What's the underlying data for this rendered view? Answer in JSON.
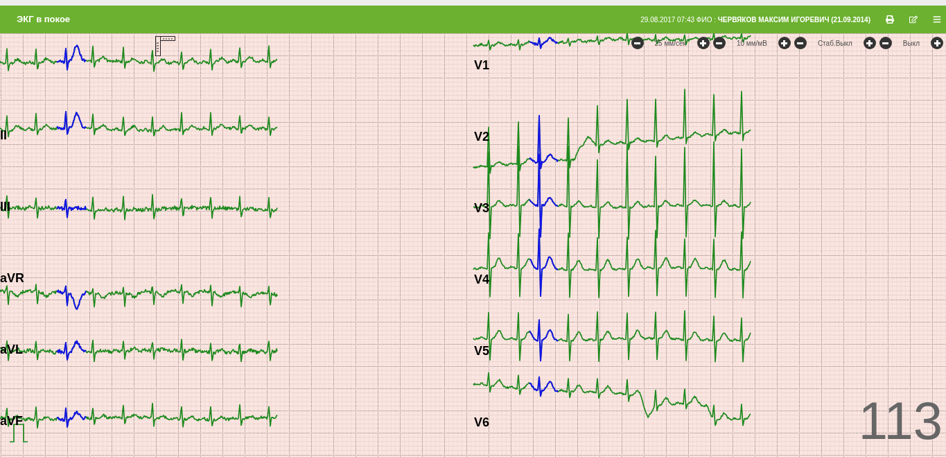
{
  "header": {
    "title": "ЭКГ в покое",
    "patient_info": "29.08.2017 07:43 ФИО : **ЧЕРВЯКОВ МАКСИМ ИГОРЕВИЧ (21.09.2014)**"
  },
  "controls": [
    "25 мм/сек",
    "10 мм/мВ",
    "Стаб.Выкл",
    "Выкл"
  ],
  "leads_left": [
    "II",
    "III",
    "aVR",
    "aVL",
    "aVF"
  ],
  "leads_right": [
    "V1",
    "V2",
    "V3",
    "V4",
    "V5",
    "V6"
  ],
  "page_number": "113"
}
